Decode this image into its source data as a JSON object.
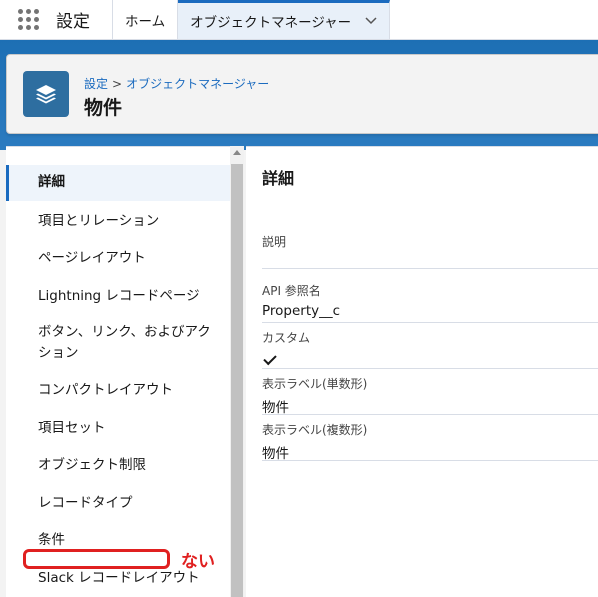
{
  "topbar": {
    "app_launcher_icon": "app-launcher-grid-icon",
    "app_name": "設定",
    "tabs": [
      {
        "label": "ホーム",
        "active": false
      },
      {
        "label": "オブジェクトマネージャー",
        "active": true,
        "chevron": "chevron-down-icon"
      }
    ]
  },
  "header": {
    "icon": "layers-icon",
    "breadcrumb": {
      "parent": "設定",
      "separator": ">",
      "current": "オブジェクトマネージャー"
    },
    "title": "物件"
  },
  "sidebar": {
    "items": [
      {
        "label": "詳細",
        "selected": true
      },
      {
        "label": "項目とリレーション"
      },
      {
        "label": "ページレイアウト"
      },
      {
        "label": "Lightning レコードページ"
      },
      {
        "label": "ボタン、リンク、およびアクション"
      },
      {
        "label": "コンパクトレイアウト"
      },
      {
        "label": "項目セット"
      },
      {
        "label": "オブジェクト制限"
      },
      {
        "label": "レコードタイプ"
      },
      {
        "label": "条件"
      },
      {
        "label": "Slack レコードレイアウト"
      }
    ]
  },
  "details": {
    "title": "詳細",
    "fields": [
      {
        "label": "説明",
        "value": ""
      },
      {
        "label": "API 参照名",
        "value": "Property__c"
      },
      {
        "label": "カスタム",
        "value_icon": "checkmark-icon"
      },
      {
        "label": "表示ラベル(単数形)",
        "value": "物件"
      },
      {
        "label": "表示ラベル(複数形)",
        "value": "物件"
      }
    ]
  },
  "annotation": {
    "text": "ない",
    "color": "#e02020"
  },
  "colors": {
    "brand_blue": "#1b6bbf",
    "band_blue": "#1d6fb4",
    "icon_bg": "#2e6ea0"
  }
}
